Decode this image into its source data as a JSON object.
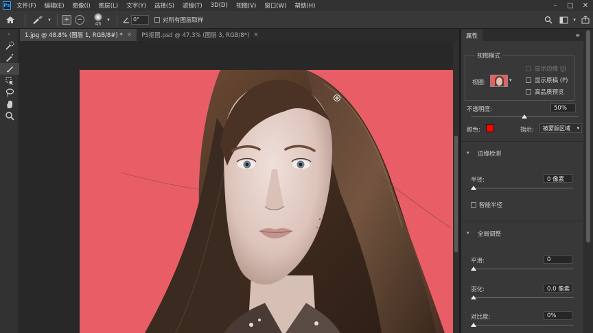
{
  "app": {
    "logo": "Ps"
  },
  "menu": [
    "文件(F)",
    "编辑(E)",
    "图像(I)",
    "图层(L)",
    "文字(Y)",
    "选择(S)",
    "滤镜(T)",
    "3D(D)",
    "视图(V)",
    "窗口(W)",
    "帮助(H)"
  ],
  "window_controls": {
    "minimize": "–",
    "maximize": "□",
    "close": "✕"
  },
  "options": {
    "brush_size": "45",
    "angle": "0°",
    "sample_all_layers": "对所有图层取样"
  },
  "tabs": [
    {
      "label": "1.jpg @ 48.8% (图层 1, RGB/8#) *",
      "close": "×"
    },
    {
      "label": "PS抠图.psd @ 47.3% (图层 3, RGB/8*)",
      "close": "×"
    }
  ],
  "panel": {
    "tab": "属性",
    "view_mode": {
      "title": "视图模式",
      "view_label": "视图:",
      "show_edges": "显示边缘 (J)",
      "show_original": "显示原稿 (P)",
      "high_quality": "高品质预览"
    },
    "opacity": {
      "label": "不透明度:",
      "value": "50%",
      "fraction": 0.5
    },
    "color": {
      "label": "颜色:",
      "swatch": "#ff0000"
    },
    "indicate": {
      "label": "指示:",
      "value": "被蒙版区域"
    },
    "edge_detection": {
      "title": "边缘检测",
      "radius_label": "半径:",
      "radius_value": "0 像素",
      "smart_radius": "智能半径"
    },
    "global_refine": {
      "title": "全局调整",
      "smooth_label": "平滑:",
      "smooth_value": "0",
      "feather_label": "羽化:",
      "feather_value": "0.0 像素",
      "contrast_label": "对比度:",
      "contrast_value": "0%"
    }
  },
  "colors": {
    "background": "#e95e66",
    "accent_swatch": "#ff0000"
  }
}
